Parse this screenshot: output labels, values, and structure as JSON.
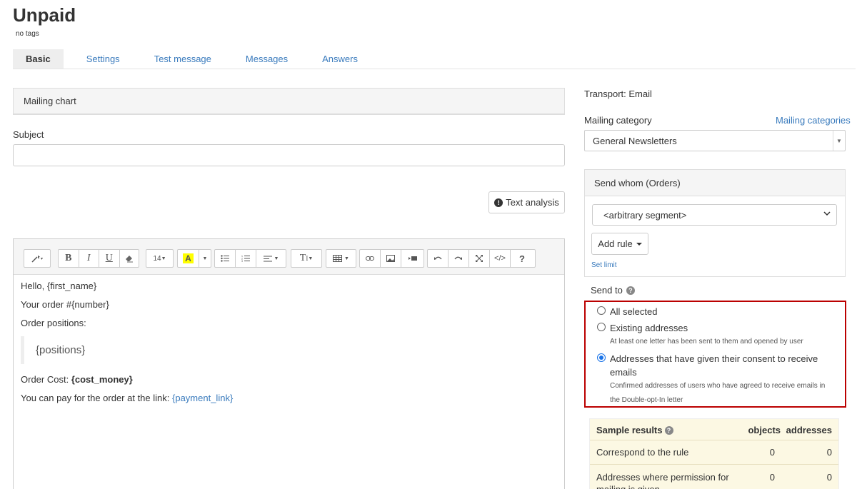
{
  "header": {
    "title": "Unpaid",
    "tags": "no tags"
  },
  "tabs": [
    "Basic",
    "Settings",
    "Test message",
    "Messages",
    "Answers"
  ],
  "left": {
    "chart_panel": "Mailing chart",
    "subject_label": "Subject",
    "subject_value": "",
    "text_analysis": "Text analysis",
    "toolbar": {
      "font_size": "14",
      "style": "T",
      "help": "?"
    },
    "content": {
      "line1": "Hello, {first_name}",
      "line2": "Your order #{number}",
      "line3": "Order positions:",
      "quote": "{positions}",
      "cost_label": "Order Cost: ",
      "cost_value": "{cost_money}",
      "pay_text": "You can pay for the order at the link: ",
      "pay_link": "{payment_link}"
    }
  },
  "right": {
    "transport": "Transport: Email",
    "category_label": "Mailing category",
    "category_link": "Mailing categories",
    "category_value": "General Newsletters",
    "whom_title": "Send whom (Orders)",
    "segment": "<arbitrary segment>",
    "add_rule": "Add rule",
    "set_limit": "Set limit",
    "send_to": "Send to",
    "options": [
      {
        "label": "All selected",
        "sub": "",
        "checked": false
      },
      {
        "label": "Existing addresses",
        "sub": "At least one letter has been sent to them and opened by user",
        "checked": false
      },
      {
        "label": "Addresses that have given their consent to receive emails",
        "sub": "Confirmed addresses of users who have agreed to receive emails in the Double-opt-In letter",
        "checked": true
      }
    ],
    "sample": {
      "title": "Sample results",
      "col_objects": "objects",
      "col_addresses": "addresses",
      "rows": [
        {
          "label": "Correspond to the rule",
          "objects": "0",
          "addresses": "0"
        },
        {
          "label": "Addresses where permission for mailing is given",
          "objects": "0",
          "addresses": "0"
        }
      ]
    }
  }
}
